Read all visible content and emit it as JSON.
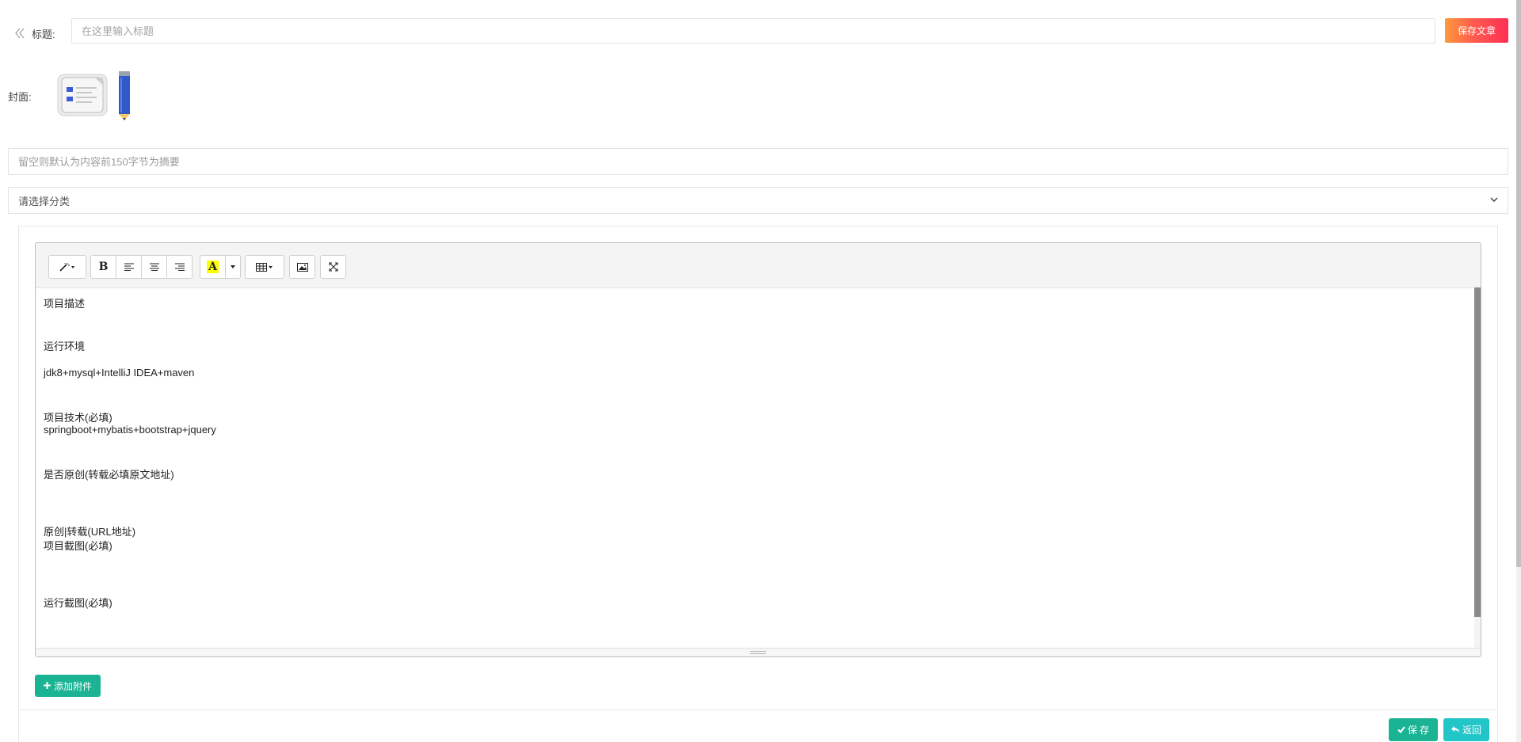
{
  "header": {
    "title_label": "标题:",
    "title_placeholder": "在这里输入标题",
    "save_article_label": "保存文章"
  },
  "cover": {
    "label": "封面:"
  },
  "summary": {
    "placeholder": "留空则默认为内容前150字节为摘要"
  },
  "category": {
    "selected": "请选择分类"
  },
  "editor": {
    "toolbar": {
      "bold": "B",
      "highlight": "A"
    },
    "content_lines": [
      "项目描述",
      "运行环境",
      "jdk8+mysql+IntelliJ IDEA+maven",
      "项目技术(必填)",
      "springboot+mybatis+bootstrap+jquery",
      "是否原创(转载必填原文地址)",
      "原创|转载(URL地址)",
      "项目截图(必填)",
      "运行截图(必填)"
    ]
  },
  "actions": {
    "attach_label": "添加附件",
    "save_label": "保 存",
    "return_label": "返回"
  },
  "colors": {
    "primary": "#1ab394",
    "info": "#23c6c8",
    "gradient_start": "#ff9a3c",
    "gradient_end": "#ff2f55"
  }
}
